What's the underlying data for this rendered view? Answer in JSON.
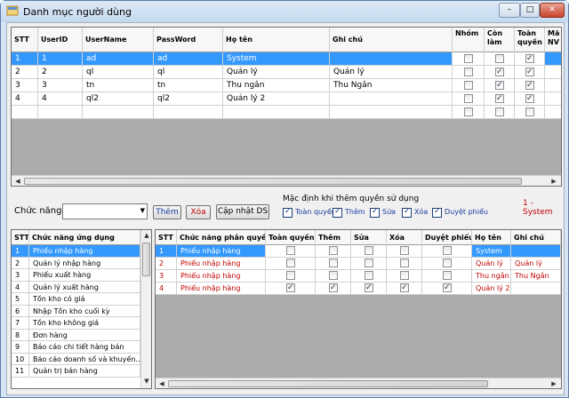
{
  "window": {
    "title": "Danh mục người dùng",
    "min": "–",
    "max": "□",
    "close": "✕"
  },
  "users_grid": {
    "columns": [
      "STT",
      "UserID",
      "UserName",
      "PassWord",
      "Họ tên",
      "Ghi chú",
      "Nhóm",
      "Còn làm",
      "Toàn quyền",
      "Mã NV"
    ],
    "rows": [
      {
        "stt": "1",
        "userid": "1",
        "username": "ad",
        "password": "ad",
        "hoten": "System",
        "ghichu": "",
        "nhom": false,
        "conlam": false,
        "toanquyen": true
      },
      {
        "stt": "2",
        "userid": "2",
        "username": "ql",
        "password": "ql",
        "hoten": "Quản lý",
        "ghichu": "Quản lý",
        "nhom": false,
        "conlam": true,
        "toanquyen": true
      },
      {
        "stt": "3",
        "userid": "3",
        "username": "tn",
        "password": "tn",
        "hoten": "Thu ngân",
        "ghichu": "Thu Ngân",
        "nhom": false,
        "conlam": true,
        "toanquyen": true
      },
      {
        "stt": "4",
        "userid": "4",
        "username": "ql2",
        "password": "ql2",
        "hoten": "Quản lý 2",
        "ghichu": "",
        "nhom": false,
        "conlam": true,
        "toanquyen": true
      },
      {
        "stt": "",
        "userid": "",
        "username": "",
        "password": "",
        "hoten": "",
        "ghichu": "",
        "nhom": false,
        "conlam": false,
        "toanquyen": false
      }
    ]
  },
  "toolbar": {
    "chuc_nang_label": "Chức năng",
    "chuc_nang_value": "",
    "them": "Thêm",
    "xoa": "Xóa",
    "cap_nhat": "Cập nhật DS",
    "default_title": "Mặc định khi thêm quyền sử dụng",
    "defaults": [
      {
        "label": "Toàn quyền",
        "checked": true
      },
      {
        "label": "Thêm",
        "checked": true
      },
      {
        "label": "Sửa",
        "checked": true
      },
      {
        "label": "Xóa",
        "checked": true
      },
      {
        "label": "Duyệt phiếu",
        "checked": true
      }
    ],
    "selected_user": "1 - System"
  },
  "functions_grid": {
    "columns": [
      "STT",
      "Chức năng ứng dụng"
    ],
    "rows": [
      [
        "1",
        "Phiếu nhập hàng"
      ],
      [
        "2",
        "Quản lý nhập hàng"
      ],
      [
        "3",
        "Phiếu xuất hàng"
      ],
      [
        "4",
        "Quản lý xuất hàng"
      ],
      [
        "5",
        "Tồn kho có giá"
      ],
      [
        "6",
        "Nhập Tồn kho cuối kỳ"
      ],
      [
        "7",
        "Tồn kho không giá"
      ],
      [
        "8",
        "Đơn hàng"
      ],
      [
        "9",
        "Báo cáo chi tiết hàng bán"
      ],
      [
        "10",
        "Báo cáo doanh số và khuyến..."
      ],
      [
        "11",
        "Quản trị bán hàng"
      ]
    ]
  },
  "perm_grid": {
    "columns": [
      "STT",
      "Chức năng phân quyền",
      "Toàn quyền",
      "Thêm",
      "Sửa",
      "Xóa",
      "Duyệt phiếu",
      "Họ tên",
      "Ghi chú"
    ],
    "rows": [
      {
        "stt": "1",
        "func": "Phiếu nhập hàng",
        "checks": [
          false,
          false,
          false,
          false,
          false
        ],
        "hoten": "System",
        "ghichu": ""
      },
      {
        "stt": "2",
        "func": "Phiếu nhập hàng",
        "checks": [
          false,
          false,
          false,
          false,
          false
        ],
        "hoten": "Quản lý",
        "ghichu": "Quản lý"
      },
      {
        "stt": "3",
        "func": "Phiếu nhập hàng",
        "checks": [
          false,
          false,
          false,
          false,
          false
        ],
        "hoten": "Thu ngân",
        "ghichu": "Thu Ngân"
      },
      {
        "stt": "4",
        "func": "Phiếu nhập hàng",
        "checks": [
          true,
          true,
          true,
          true,
          true
        ],
        "hoten": "Quản lý 2",
        "ghichu": ""
      }
    ]
  },
  "scroll": {
    "left": "◀",
    "right": "▶",
    "up": "▲",
    "down": "▼"
  },
  "colors": {
    "selection": "#3399ff",
    "red_text": "#c00000",
    "blue_label": "#1a3c9e"
  }
}
